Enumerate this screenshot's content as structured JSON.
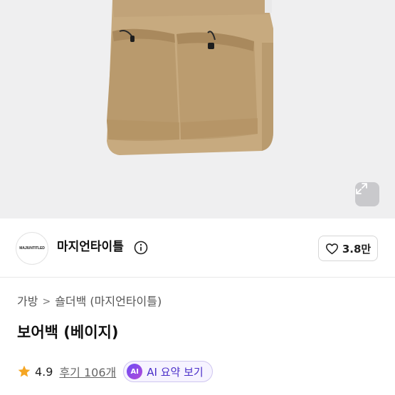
{
  "shop": {
    "logo_text": "MAJIUNTITLED",
    "name": "마지언타이틀",
    "favorite_count": "3.8만"
  },
  "breadcrumb": {
    "items": [
      "가방",
      "숄더백 (마지언타이틀)"
    ],
    "separator": ">"
  },
  "product": {
    "title": "보어백 (베이지)",
    "rating": "4.9",
    "reviews_label": "후기 106개"
  },
  "ai_summary": {
    "badge": "AI",
    "label": "AI 요약 보기"
  },
  "icons": {
    "zoom": "expand-icon",
    "info": "info-icon",
    "favorite": "heart-icon",
    "rating": "star-icon",
    "breadcrumb_separator": "chevron-right-icon"
  },
  "colors": {
    "bag": "#c2a57a",
    "star": "#f5a623",
    "ai_accent": "#6d4cf5"
  }
}
